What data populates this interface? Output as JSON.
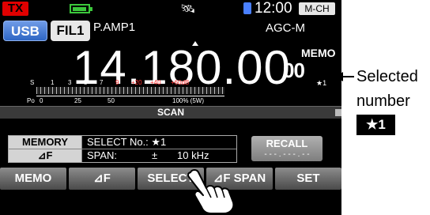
{
  "status": {
    "tx": "TX",
    "clock": "12:00",
    "memory_channel": "M-CH"
  },
  "top_row": {
    "mode": "USB",
    "filter": "FIL1",
    "preamp": "P.AMP1",
    "agc": "AGC-M"
  },
  "frequency": "14.180.00",
  "memo_indicator": {
    "label": "MEMO",
    "channel": "00",
    "selected": "★1"
  },
  "meter": {
    "s_scale": [
      "S",
      "1",
      "3",
      "5",
      "7",
      "9",
      "+20",
      "+40",
      "+60dB"
    ],
    "po_scale": [
      "Po",
      "0",
      "25",
      "50",
      "100% (5W)"
    ]
  },
  "scan": {
    "title": "SCAN",
    "rows": [
      {
        "label": "MEMORY",
        "text": "SELECT No.: ★1"
      },
      {
        "label": "⊿F",
        "text": "SPAN:",
        "sign": "±",
        "value": "10 kHz"
      }
    ],
    "recall": {
      "label": "RECALL",
      "freq": "- - - . - - - . - -"
    }
  },
  "softkeys": [
    "MEMO",
    "⊿F",
    "SELECT",
    "⊿F SPAN",
    "SET"
  ],
  "callout": {
    "line1": "Selected",
    "line2": "number",
    "badge": "★1"
  },
  "colors": {
    "tx": "#e00000",
    "battery": "#3cc83c",
    "mode_button": "#2e66c4",
    "s_scale_over9": "#ff3030"
  }
}
